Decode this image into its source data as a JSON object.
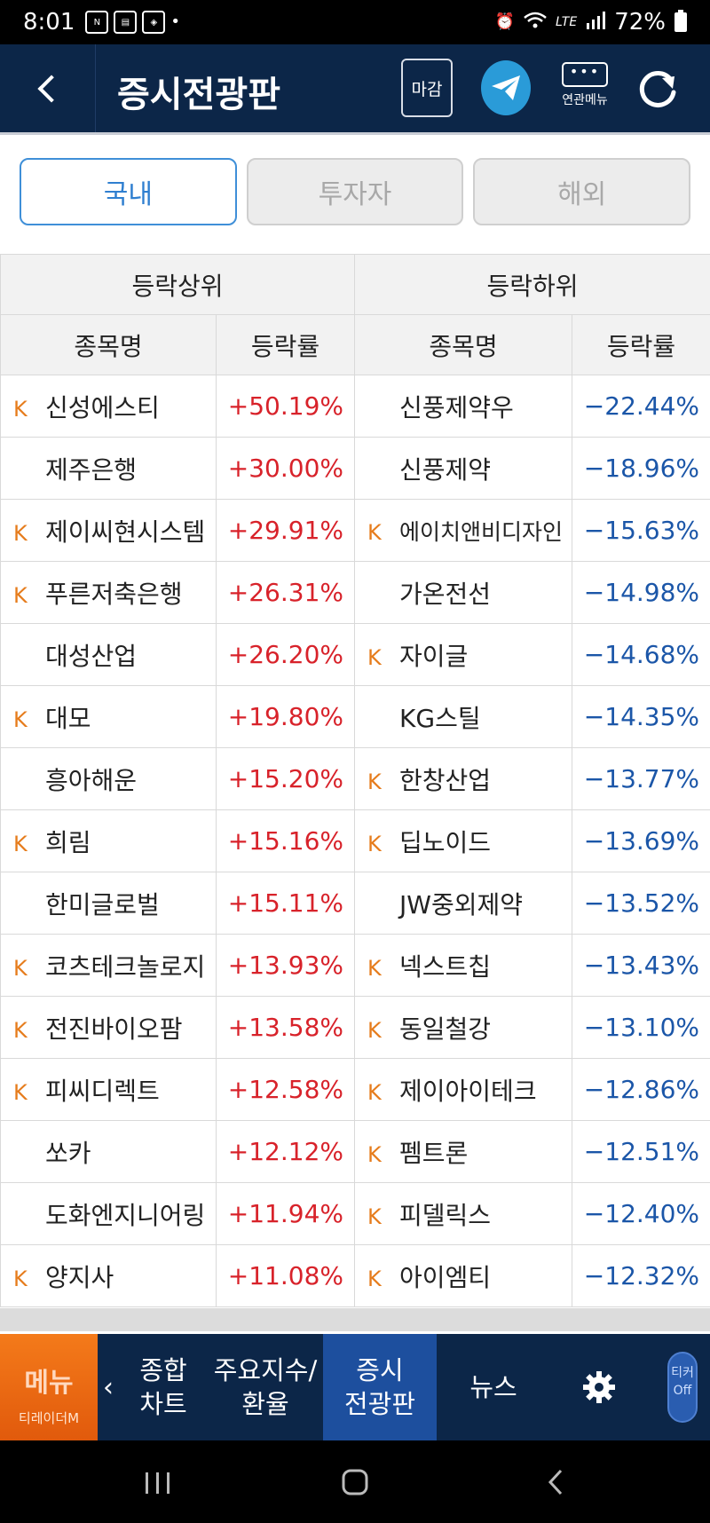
{
  "status_bar": {
    "time": "8:01",
    "battery": "72%",
    "network": "LTE"
  },
  "header": {
    "title": "증시전광판",
    "close_label": "마감",
    "related_menu_label": "연관메뉴"
  },
  "tabs": [
    {
      "label": "국내",
      "active": true
    },
    {
      "label": "투자자",
      "active": false
    },
    {
      "label": "해외",
      "active": false
    }
  ],
  "table": {
    "group_headers": {
      "top": "등락상위",
      "bottom": "등락하위"
    },
    "col_headers": {
      "name": "종목명",
      "rate": "등락률"
    },
    "k_mark": "K",
    "rows": [
      {
        "top_k": true,
        "top_name": "신성에스티",
        "top_rate": "+50.19%",
        "bot_k": false,
        "bot_name": "신풍제약우",
        "bot_rate": "−22.44%"
      },
      {
        "top_k": false,
        "top_name": "제주은행",
        "top_rate": "+30.00%",
        "bot_k": false,
        "bot_name": "신풍제약",
        "bot_rate": "−18.96%"
      },
      {
        "top_k": true,
        "top_name": "제이씨현시스템",
        "top_rate": "+29.91%",
        "bot_k": true,
        "bot_name": "에이치앤비디자인",
        "bot_rate": "−15.63%"
      },
      {
        "top_k": true,
        "top_name": "푸른저축은행",
        "top_rate": "+26.31%",
        "bot_k": false,
        "bot_name": "가온전선",
        "bot_rate": "−14.98%"
      },
      {
        "top_k": false,
        "top_name": "대성산업",
        "top_rate": "+26.20%",
        "bot_k": true,
        "bot_name": "자이글",
        "bot_rate": "−14.68%"
      },
      {
        "top_k": true,
        "top_name": "대모",
        "top_rate": "+19.80%",
        "bot_k": false,
        "bot_name": "KG스틸",
        "bot_rate": "−14.35%"
      },
      {
        "top_k": false,
        "top_name": "흥아해운",
        "top_rate": "+15.20%",
        "bot_k": true,
        "bot_name": "한창산업",
        "bot_rate": "−13.77%"
      },
      {
        "top_k": true,
        "top_name": "희림",
        "top_rate": "+15.16%",
        "bot_k": true,
        "bot_name": "딥노이드",
        "bot_rate": "−13.69%"
      },
      {
        "top_k": false,
        "top_name": "한미글로벌",
        "top_rate": "+15.11%",
        "bot_k": false,
        "bot_name": "JW중외제약",
        "bot_rate": "−13.52%"
      },
      {
        "top_k": true,
        "top_name": "코츠테크놀로지",
        "top_rate": "+13.93%",
        "bot_k": true,
        "bot_name": "넥스트칩",
        "bot_rate": "−13.43%"
      },
      {
        "top_k": true,
        "top_name": "전진바이오팜",
        "top_rate": "+13.58%",
        "bot_k": true,
        "bot_name": "동일철강",
        "bot_rate": "−13.10%"
      },
      {
        "top_k": true,
        "top_name": "피씨디렉트",
        "top_rate": "+12.58%",
        "bot_k": true,
        "bot_name": "제이아이테크",
        "bot_rate": "−12.86%"
      },
      {
        "top_k": false,
        "top_name": "쏘카",
        "top_rate": "+12.12%",
        "bot_k": true,
        "bot_name": "펨트론",
        "bot_rate": "−12.51%"
      },
      {
        "top_k": false,
        "top_name": "도화엔지니어링",
        "top_rate": "+11.94%",
        "bot_k": true,
        "bot_name": "피델릭스",
        "bot_rate": "−12.40%"
      },
      {
        "top_k": true,
        "top_name": "양지사",
        "top_rate": "+11.08%",
        "bot_k": true,
        "bot_name": "아이엠티",
        "bot_rate": "−12.32%"
      }
    ]
  },
  "bottom_nav": {
    "menu_label": "메뉴",
    "brand_label": "티레이더M",
    "items": [
      {
        "line1": "종합",
        "line2": "차트",
        "active": false
      },
      {
        "line1": "주요지수/",
        "line2": "환율",
        "active": false
      },
      {
        "line1": "증시",
        "line2": "전광판",
        "active": true
      },
      {
        "line1": "뉴스",
        "line2": "",
        "active": false
      }
    ],
    "ticker_label_1": "티커",
    "ticker_label_2": "Off"
  },
  "colors": {
    "header_bg": "#0c2648",
    "up": "#d8222a",
    "down": "#1b56a8",
    "kospi_mark": "#e67c1c",
    "accent": "#2f7fd0"
  }
}
